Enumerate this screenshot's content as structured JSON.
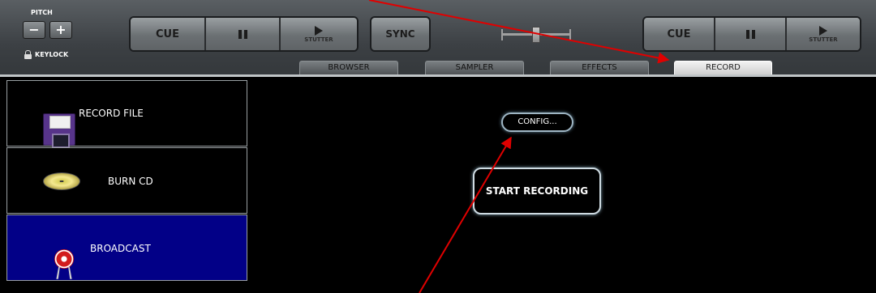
{
  "deck_left": {
    "pitch_label": "PITCH",
    "minus_label": "−",
    "plus_label": "+",
    "keylock_label": "KEYLOCK",
    "cue_label": "CUE",
    "stutter_label": "STUTTER"
  },
  "center": {
    "sync_label": "SYNC"
  },
  "deck_right": {
    "cue_label": "CUE",
    "stutter_label": "STUTTER"
  },
  "tabs": [
    {
      "label": "BROWSER"
    },
    {
      "label": "SAMPLER"
    },
    {
      "label": "EFFECTS"
    },
    {
      "label": "RECORD"
    }
  ],
  "active_tab": "RECORD",
  "sidebar": {
    "items": [
      {
        "label": "RECORD FILE",
        "icon": "floppy-disk-icon"
      },
      {
        "label": "BURN CD",
        "icon": "cd-icon"
      },
      {
        "label": "BROADCAST",
        "icon": "broadcast-tower-icon",
        "selected": true
      }
    ]
  },
  "main": {
    "config_label": "CONFIG...",
    "start_recording_label": "START RECORDING"
  },
  "colors": {
    "selected_item": "#020087",
    "annotation_arrow": "#e00000"
  }
}
